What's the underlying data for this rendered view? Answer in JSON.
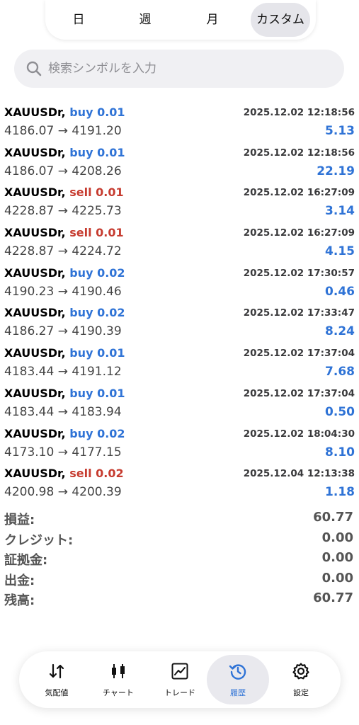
{
  "period_tabs": {
    "day": "日",
    "week": "週",
    "month": "月",
    "custom": "カスタム",
    "active": "custom"
  },
  "search": {
    "placeholder": "検索シンボルを入力"
  },
  "trades": [
    {
      "symbol": "XAUUSDr,",
      "direction": "buy 0.01",
      "side": "buy",
      "time": "2025.12.02 12:18:56",
      "prices": "4186.07 → 4191.20",
      "profit": "5.13"
    },
    {
      "symbol": "XAUUSDr,",
      "direction": "buy 0.01",
      "side": "buy",
      "time": "2025.12.02 12:18:56",
      "prices": "4186.07 → 4208.26",
      "profit": "22.19"
    },
    {
      "symbol": "XAUUSDr,",
      "direction": "sell 0.01",
      "side": "sell",
      "time": "2025.12.02 16:27:09",
      "prices": "4228.87 → 4225.73",
      "profit": "3.14"
    },
    {
      "symbol": "XAUUSDr,",
      "direction": "sell 0.01",
      "side": "sell",
      "time": "2025.12.02 16:27:09",
      "prices": "4228.87 → 4224.72",
      "profit": "4.15"
    },
    {
      "symbol": "XAUUSDr,",
      "direction": "buy 0.02",
      "side": "buy",
      "time": "2025.12.02 17:30:57",
      "prices": "4190.23 → 4190.46",
      "profit": "0.46"
    },
    {
      "symbol": "XAUUSDr,",
      "direction": "buy 0.02",
      "side": "buy",
      "time": "2025.12.02 17:33:47",
      "prices": "4186.27 → 4190.39",
      "profit": "8.24"
    },
    {
      "symbol": "XAUUSDr,",
      "direction": "buy 0.01",
      "side": "buy",
      "time": "2025.12.02 17:37:04",
      "prices": "4183.44 → 4191.12",
      "profit": "7.68"
    },
    {
      "symbol": "XAUUSDr,",
      "direction": "buy 0.01",
      "side": "buy",
      "time": "2025.12.02 17:37:04",
      "prices": "4183.44 → 4183.94",
      "profit": "0.50"
    },
    {
      "symbol": "XAUUSDr,",
      "direction": "buy 0.02",
      "side": "buy",
      "time": "2025.12.02 18:04:30",
      "prices": "4173.10 → 4177.15",
      "profit": "8.10"
    },
    {
      "symbol": "XAUUSDr,",
      "direction": "sell 0.02",
      "side": "sell",
      "time": "2025.12.04 12:13:38",
      "prices": "4200.98 → 4200.39",
      "profit": "1.18"
    }
  ],
  "summary": [
    {
      "label": "損益:",
      "value": "60.77"
    },
    {
      "label": "クレジット:",
      "value": "0.00"
    },
    {
      "label": "証拠金:",
      "value": "0.00"
    },
    {
      "label": "出金:",
      "value": "0.00"
    },
    {
      "label": "残高:",
      "value": "60.77"
    }
  ],
  "nav": {
    "items": [
      {
        "key": "quotes",
        "label": "気配値",
        "icon": "arrows-up-down-icon"
      },
      {
        "key": "chart",
        "label": "チャート",
        "icon": "candlestick-icon"
      },
      {
        "key": "trade",
        "label": "トレード",
        "icon": "line-chart-icon"
      },
      {
        "key": "history",
        "label": "履歴",
        "icon": "history-icon"
      },
      {
        "key": "settings",
        "label": "設定",
        "icon": "gear-icon"
      }
    ],
    "active": "history"
  },
  "colors": {
    "buy": "#2f73d6",
    "sell": "#c63b2f",
    "profit": "#2f73d6",
    "active_tab_bg": "#e5e5ea",
    "active_nav_label": "#2f73d6"
  }
}
